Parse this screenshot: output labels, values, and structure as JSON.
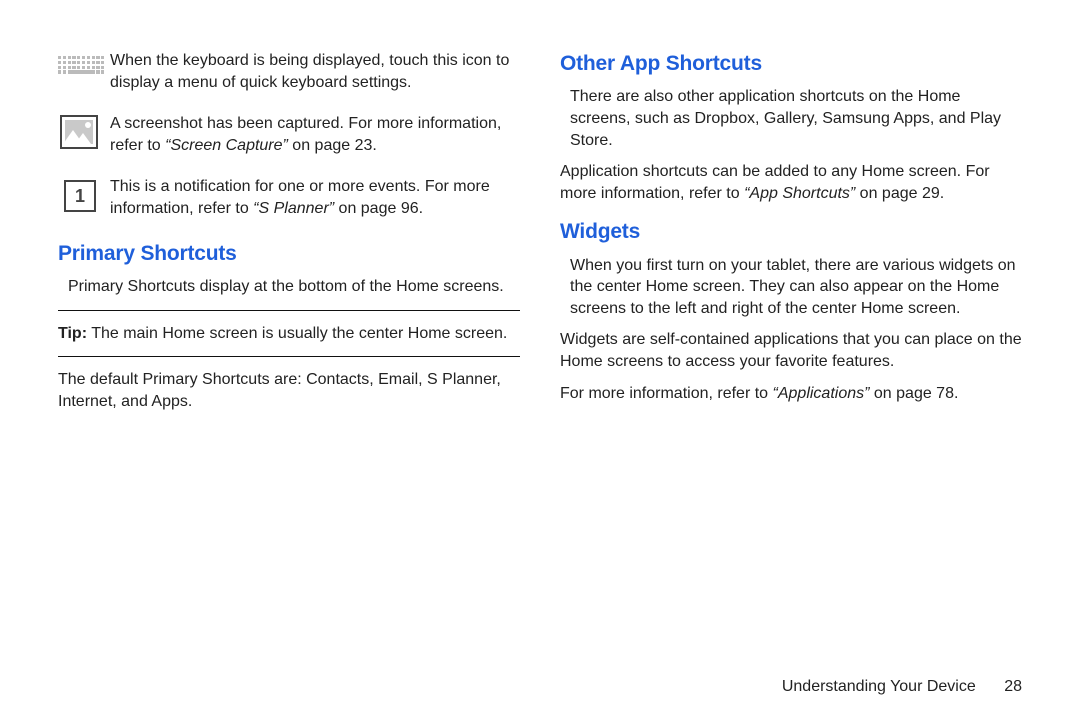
{
  "left": {
    "icons": [
      {
        "text_a": "When the keyboard is being displayed, touch this icon to display a menu of quick keyboard settings."
      },
      {
        "text_a": "A screenshot has been captured. For more information, refer to ",
        "ref": "“Screen Capture”",
        "text_b": " on page 23."
      },
      {
        "badge": "1",
        "text_a": "This is a notification for one or more events. For more information, refer to ",
        "ref": "“S Planner”",
        "text_b": " on page 96."
      }
    ],
    "h_primary": "Primary Shortcuts",
    "p_primary_intro": "Primary Shortcuts display at the bottom of the Home screens.",
    "tip_label": "Tip:",
    "tip_text": " The main Home screen is usually the center Home screen.",
    "p_primary_default": "The default Primary Shortcuts are: Contacts, Email, S Planner, Internet, and Apps."
  },
  "right": {
    "h_other": "Other App Shortcuts",
    "p_other_1": "There are also other application shortcuts on the Home screens, such as Dropbox, Gallery, Samsung Apps, and Play Store.",
    "p_other_2a": "Application shortcuts can be added to any Home screen. For more information, refer to ",
    "p_other_2_ref": "“App Shortcuts”",
    "p_other_2b": " on page 29.",
    "h_widgets": "Widgets",
    "p_widgets_1": "When you first turn on your tablet, there are various widgets on the center Home screen. They can also appear on the Home screens to the left and right of the center Home screen.",
    "p_widgets_2": "Widgets are self-contained applications that you can place on the Home screens to access your favorite features.",
    "p_widgets_3a": "For more information, refer to ",
    "p_widgets_3_ref": "“Applications”",
    "p_widgets_3b": " on page 78."
  },
  "footer": {
    "section": "Understanding Your Device",
    "page": "28"
  }
}
